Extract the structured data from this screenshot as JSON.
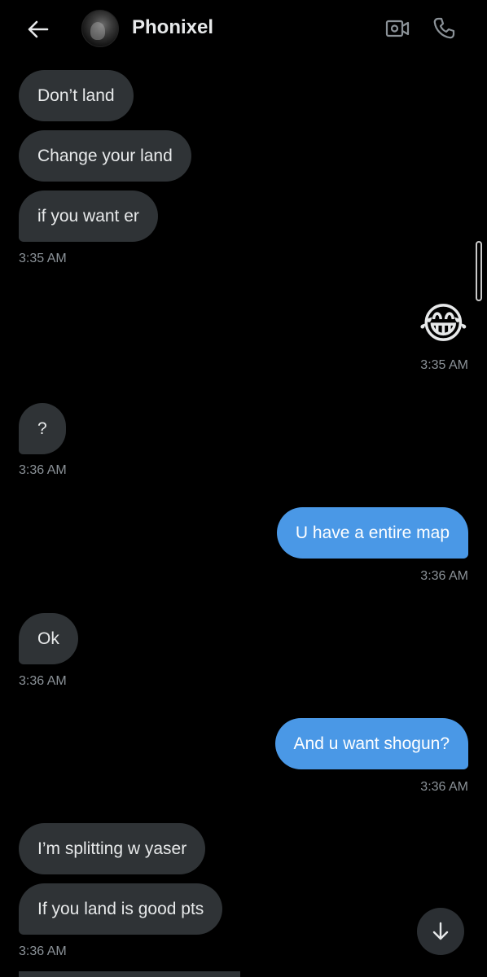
{
  "header": {
    "contact_name": "Phonixel",
    "icons": {
      "back": "arrow-left-icon",
      "video": "video-camera-icon",
      "phone": "phone-icon"
    }
  },
  "messages": [
    {
      "direction": "incoming",
      "text": "Don’t land"
    },
    {
      "direction": "incoming",
      "text": "Change your land"
    },
    {
      "direction": "incoming",
      "text": "if you want er"
    },
    {
      "direction": "timestamp-left",
      "text": "3:35 AM"
    },
    {
      "direction": "outgoing-emoji",
      "text": "😂"
    },
    {
      "direction": "timestamp-right",
      "text": "3:35 AM"
    },
    {
      "direction": "incoming",
      "text": "?"
    },
    {
      "direction": "timestamp-left",
      "text": "3:36 AM"
    },
    {
      "direction": "outgoing",
      "text": "U have a entire map"
    },
    {
      "direction": "timestamp-right",
      "text": "3:36 AM"
    },
    {
      "direction": "incoming",
      "text": "Ok"
    },
    {
      "direction": "timestamp-left",
      "text": "3:36 AM"
    },
    {
      "direction": "outgoing",
      "text": "And u want shogun?"
    },
    {
      "direction": "timestamp-right",
      "text": "3:36 AM"
    },
    {
      "direction": "incoming",
      "text": "I’m splitting w yaser"
    },
    {
      "direction": "incoming",
      "text": "If you land is good pts"
    },
    {
      "direction": "timestamp-left",
      "text": "3:36 AM"
    }
  ],
  "scroll_to_bottom": {
    "icon": "arrow-down-icon"
  },
  "colors": {
    "incoming_bubble": "#2f3336",
    "outgoing_bubble": "#4a98e6",
    "background": "#000000",
    "timestamp": "#8b9298"
  }
}
